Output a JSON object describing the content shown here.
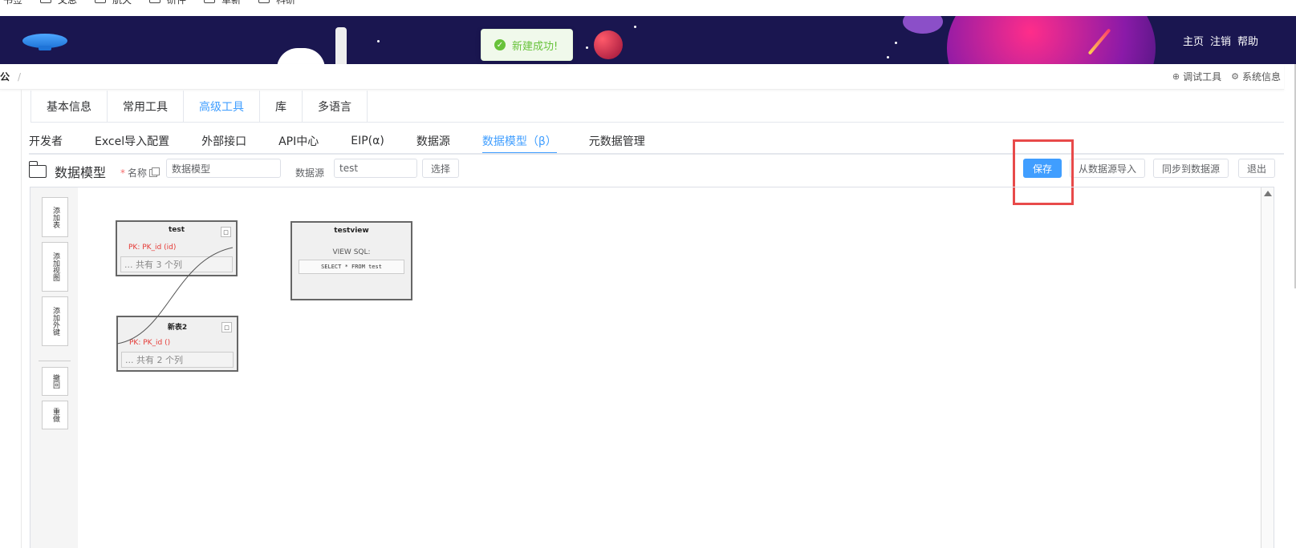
{
  "bookmarks": {
    "items": [
      {
        "label": "书签",
        "folder": false
      },
      {
        "label": "文息",
        "folder": true
      },
      {
        "label": "航天",
        "folder": true
      },
      {
        "label": "研件",
        "folder": true
      },
      {
        "label": "革新",
        "folder": true
      },
      {
        "label": "科研",
        "folder": true
      }
    ]
  },
  "banner": {
    "links": [
      "主页",
      "注销",
      "帮助"
    ],
    "colors": {
      "background": "#1a1650"
    }
  },
  "toast": {
    "message": "新建成功!",
    "icon": "check-circle-icon",
    "color": "#67c23a"
  },
  "breadcrumb": {
    "current": "公",
    "separator": "/"
  },
  "header_tools": {
    "debug": "调试工具",
    "system": "系统信息"
  },
  "tabs_primary": {
    "items": [
      "基本信息",
      "常用工具",
      "高级工具",
      "库",
      "多语言"
    ],
    "active_index": 2
  },
  "tabs_secondary": {
    "items": [
      "开发者",
      "Excel导入配置",
      "外部接口",
      "API中心",
      "EIP(α)",
      "数据源",
      "数据模型（β）",
      "元数据管理"
    ],
    "active_index": 6
  },
  "toolbar": {
    "title": "数据模型",
    "required_mark": "*",
    "name_label": "名称",
    "name_value": "数据模型",
    "datasource_label": "数据源",
    "datasource_value": "test",
    "select_label": "选择",
    "save_label": "保存",
    "import_label": "从数据源导入",
    "sync_label": "同步到数据源",
    "exit_label": "退出",
    "accent": "#409eff"
  },
  "palette": {
    "add_table": "添加表",
    "add_view": "添加视图",
    "add_fk": "添加外键",
    "undo": "撤回",
    "redo": "重做"
  },
  "diagram": {
    "tables": [
      {
        "name": "test",
        "pk": "PK: PK_id (id)",
        "columns": "... 共有 3 个列",
        "close": "□"
      },
      {
        "name": "新表2",
        "pk": "PK: PK_id ()",
        "columns": "... 共有 2 个列",
        "close": "□"
      }
    ],
    "view": {
      "name": "testview",
      "sql_label": "VIEW SQL:",
      "sql": "SELECT * FROM test"
    }
  }
}
